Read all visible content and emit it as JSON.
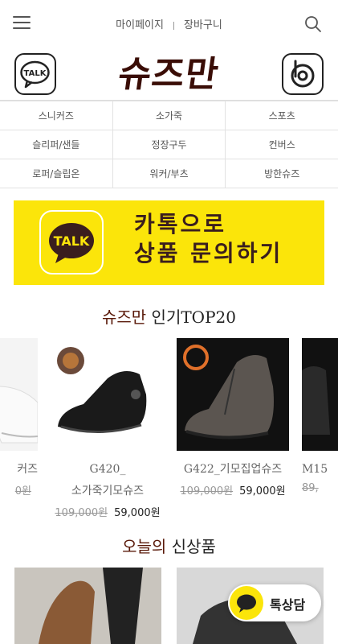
{
  "header": {
    "mypage_label": "마이페이지",
    "cart_label": "장바구니"
  },
  "logo_text": "슈즈만",
  "categories": [
    [
      "스니커즈",
      "소가죽",
      "스포츠"
    ],
    [
      "슬리퍼/샌들",
      "정장구두",
      "컨버스"
    ],
    [
      "로퍼/슬립온",
      "워커/부츠",
      "방한슈즈"
    ]
  ],
  "banner": {
    "badge_text": "TALK",
    "line1": "카톡으로",
    "line2": "상품 문의하기",
    "color": "#fbe50a"
  },
  "popular": {
    "brand": "슈즈만",
    "title": " 인기TOP20",
    "items": [
      {
        "name": "커즈",
        "name2": "",
        "old_price": "0원",
        "price": ""
      },
      {
        "name": "G420_",
        "name2": "소가죽기모슈즈",
        "old_price": "109,000원",
        "price": "59,000원"
      },
      {
        "name": "G422_기모집업슈즈",
        "name2": "",
        "old_price": "109,000원",
        "price": "59,000원"
      },
      {
        "name": "M15",
        "name2": "",
        "old_price": "89,",
        "price": ""
      }
    ]
  },
  "new_section": {
    "brand": "오늘의",
    "title": " 신상품"
  },
  "chat_button": {
    "label": "톡상담"
  },
  "icons": {
    "menu": "menu-icon",
    "search": "search-icon",
    "kakaotalk": "kakaotalk-icon",
    "blog": "blog-icon"
  }
}
